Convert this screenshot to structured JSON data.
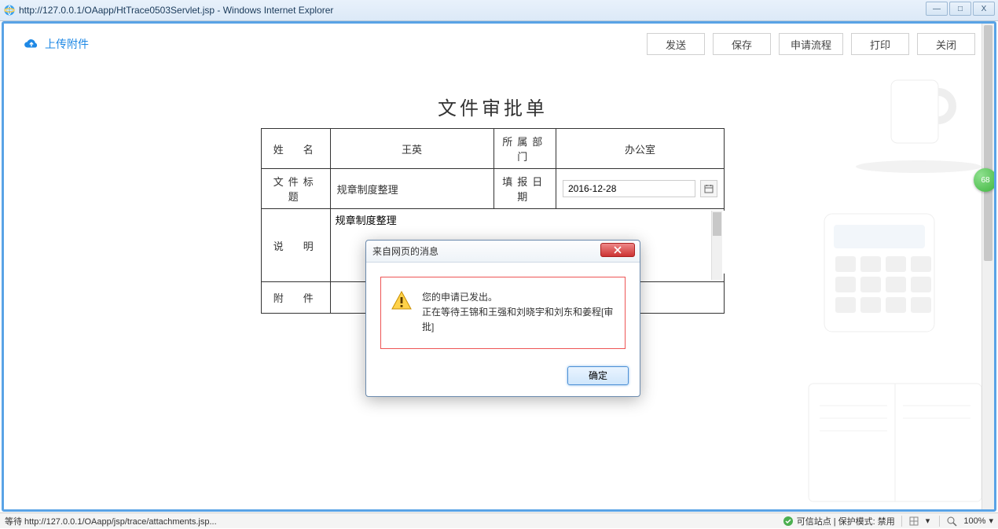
{
  "titlebar": {
    "url_text": "http://127.0.0.1/OAapp/HtTrace0503Servlet.jsp - Windows Internet Explorer"
  },
  "window_controls": {
    "min": "—",
    "max": "□",
    "close": "X"
  },
  "toolbar": {
    "upload_label": "上传附件",
    "buttons": [
      "发送",
      "保存",
      "申请流程",
      "打印",
      "关闭"
    ]
  },
  "form": {
    "title": "文件审批单",
    "labels": {
      "name": "姓　名",
      "dept": "所属部门",
      "subject": "文件标题",
      "fill_date": "填报日期",
      "desc": "说　明",
      "attach": "附　件"
    },
    "values": {
      "name": "王英",
      "dept": "办公室",
      "subject": "规章制度整理",
      "fill_date": "2016-12-28",
      "desc": "规章制度整理",
      "attach": ""
    }
  },
  "dialog": {
    "title": "来自网页的消息",
    "line1": "您的申请已发出。",
    "line2": "正在等待王锦和王强和刘晓宇和刘东和姜程[审批]",
    "ok": "确定"
  },
  "statusbar": {
    "left": "等待 http://127.0.0.1/OAapp/jsp/trace/attachments.jsp...",
    "trusted": "可信站点 | 保护模式: 禁用",
    "zoom": "100%"
  },
  "side_bubble": "68"
}
